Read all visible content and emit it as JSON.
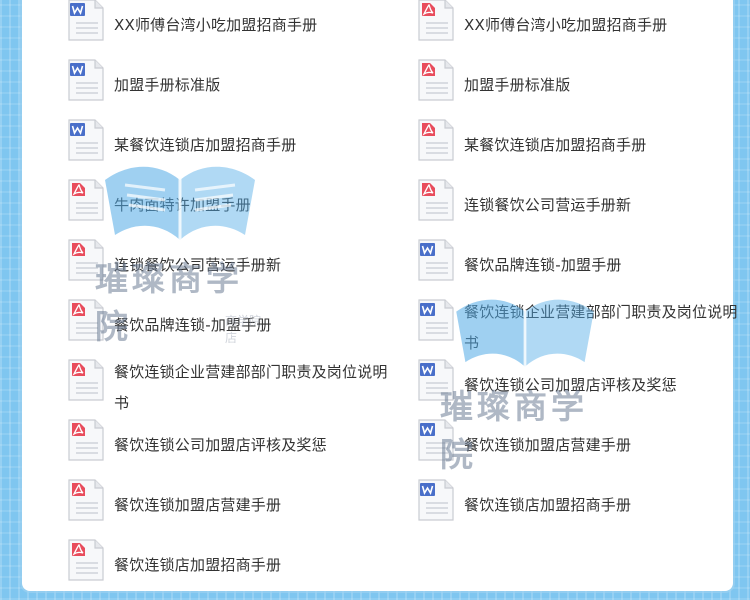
{
  "left_column": [
    {
      "label": "XX师傅台湾小吃加盟招商手册",
      "type": "word"
    },
    {
      "label": "加盟手册标准版",
      "type": "word"
    },
    {
      "label": "某餐饮连锁店加盟招商手册",
      "type": "word"
    },
    {
      "label": "牛肉面特许加盟手册",
      "type": "pdf"
    },
    {
      "label": "连锁餐饮公司营运手册新",
      "type": "pdf"
    },
    {
      "label": "餐饮品牌连锁-加盟手册",
      "type": "pdf"
    },
    {
      "label": "餐饮连锁企业营建部部门职责及岗位说明书",
      "type": "pdf"
    },
    {
      "label": "餐饮连锁公司加盟店评核及奖惩",
      "type": "pdf"
    },
    {
      "label": "餐饮连锁加盟店营建手册",
      "type": "pdf"
    },
    {
      "label": "餐饮连锁店加盟招商手册",
      "type": "pdf"
    }
  ],
  "right_column": [
    {
      "label": "XX师傅台湾小吃加盟招商手册",
      "type": "pdf"
    },
    {
      "label": "加盟手册标准版",
      "type": "pdf"
    },
    {
      "label": "某餐饮连锁店加盟招商手册",
      "type": "pdf"
    },
    {
      "label": "连锁餐饮公司营运手册新",
      "type": "pdf"
    },
    {
      "label": "餐饮品牌连锁-加盟手册",
      "type": "word"
    },
    {
      "label": "餐饮连锁企业营建部部门职责及岗位说明书",
      "type": "word"
    },
    {
      "label": "餐饮连锁公司加盟店评核及奖惩",
      "type": "word"
    },
    {
      "label": "餐饮连锁加盟店营建手册",
      "type": "word"
    },
    {
      "label": "餐饮连锁店加盟招商手册",
      "type": "word"
    }
  ],
  "watermark": {
    "text": "璀璨商学院",
    "sub": "商学院 店"
  },
  "colors": {
    "word": "#4a6fc9",
    "pdf": "#e84c5c",
    "text": "#333333",
    "background": "#7fc6f0"
  }
}
